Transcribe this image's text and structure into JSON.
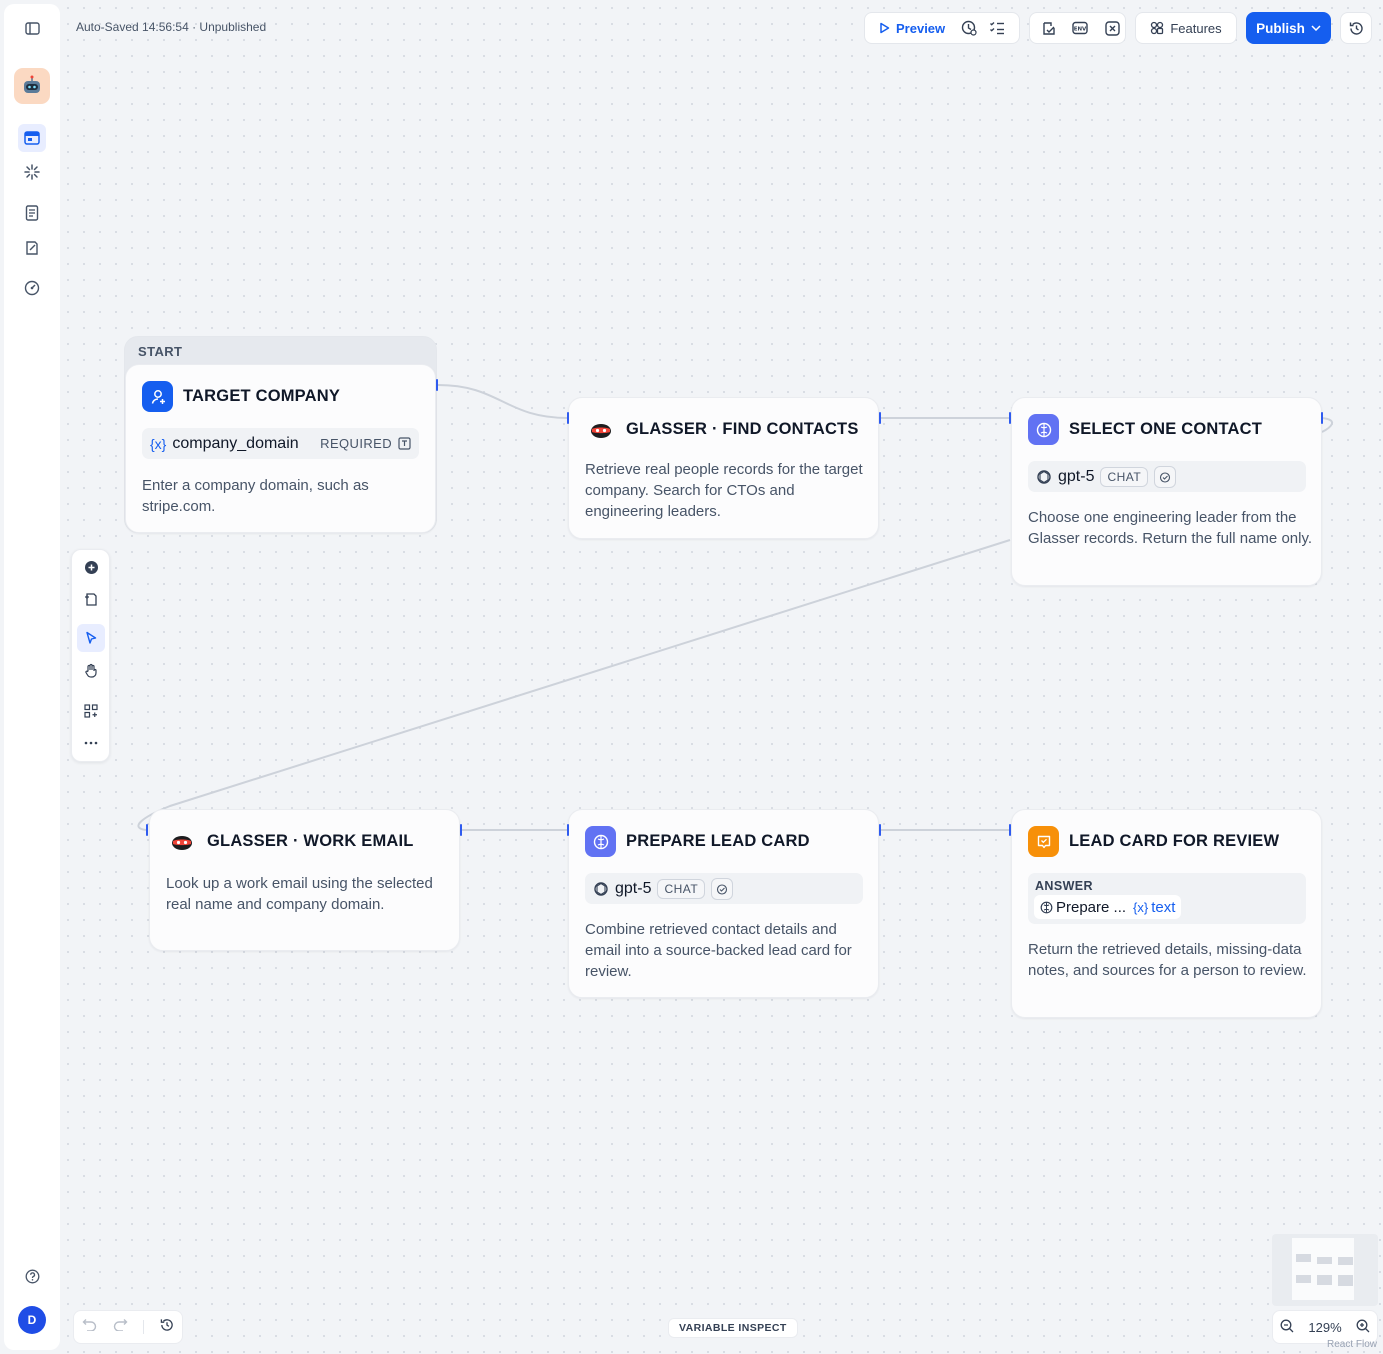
{
  "header": {
    "autosave_text": "Auto-Saved 14:56:54 · Unpublished",
    "preview_label": "Preview",
    "features_label": "Features",
    "publish_label": "Publish"
  },
  "nodes": {
    "start": {
      "section_label": "START",
      "title": "TARGET COMPANY",
      "variable": "company_domain",
      "variable_prefix": "{x}",
      "required_label": "REQUIRED",
      "description": "Enter a company domain, such as stripe.com."
    },
    "find_contacts": {
      "title": "GLASSER · FIND CONTACTS",
      "description": "Retrieve real people records for the target company. Search for CTOs and engineering leaders."
    },
    "select_contact": {
      "title": "SELECT ONE CONTACT",
      "model": "gpt-5",
      "mode": "CHAT",
      "description": "Choose one engineering leader from the Glasser records. Return the full name only."
    },
    "work_email": {
      "title": "GLASSER · WORK EMAIL",
      "description": "Look up a work email using the selected real name and company domain."
    },
    "prepare_card": {
      "title": "PREPARE LEAD CARD",
      "model": "gpt-5",
      "mode": "CHAT",
      "description": "Combine retrieved contact details and email into a source-backed lead card for review."
    },
    "lead_card": {
      "title": "LEAD CARD FOR REVIEW",
      "answer_label": "ANSWER",
      "answer_source": "Prepare ...",
      "answer_var_prefix": "{x}",
      "answer_var": "text",
      "description": "Return the retrieved details, missing-data notes, and sources for a person to review."
    }
  },
  "bottom": {
    "variable_inspect": "VARIABLE INSPECT",
    "zoom": "129%",
    "attribution": "React Flow"
  },
  "user": {
    "initial": "D"
  },
  "colors": {
    "accent": "#155eef",
    "llm_icon": "#6172f3",
    "answer_icon": "#f79009",
    "start_icon": "#155eef"
  }
}
